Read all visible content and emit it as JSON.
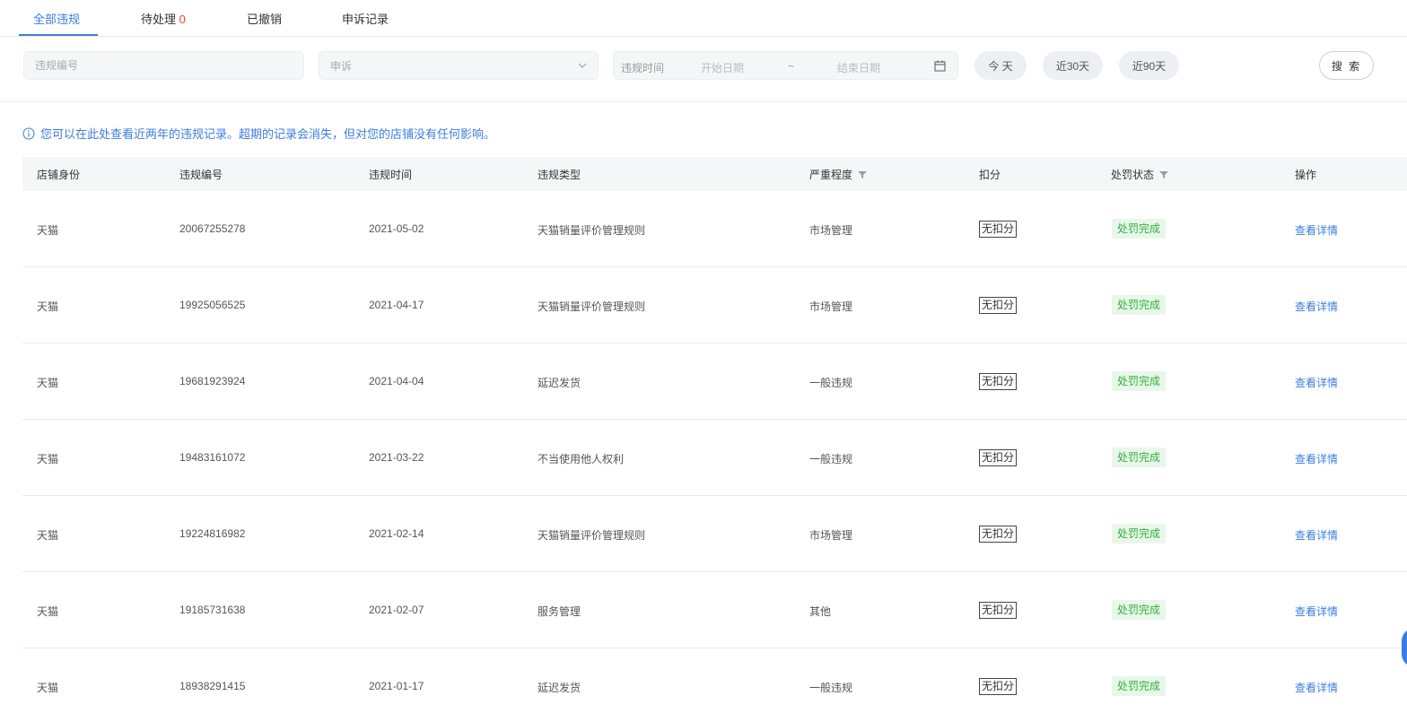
{
  "tabs": [
    {
      "label": "全部违规",
      "active": true
    },
    {
      "label": "待处理",
      "count": "0"
    },
    {
      "label": "已撤销"
    },
    {
      "label": "申诉记录"
    }
  ],
  "filters": {
    "violation_no_placeholder": "违规编号",
    "appeal_select_value": "申诉",
    "time_label": "违规时间",
    "start_placeholder": "开始日期",
    "separator": "~",
    "end_placeholder": "结束日期",
    "quick": [
      "今 天",
      "近30天",
      "近90天"
    ],
    "search_label": "搜 索"
  },
  "notice": "您可以在此处查看近两年的违规记录。超期的记录会消失，但对您的店铺没有任何影响。",
  "table": {
    "headers": [
      "店铺身份",
      "违规编号",
      "违规时间",
      "违规类型",
      "严重程度",
      "扣分",
      "处罚状态",
      "操作"
    ],
    "rows": [
      {
        "shop": "天猫",
        "id": "20067255278",
        "date": "2021-05-02",
        "type": "天猫销量评价管理规则",
        "severity": "市场管理",
        "score": "无扣分",
        "status": "处罚完成",
        "action": "查看详情"
      },
      {
        "shop": "天猫",
        "id": "19925056525",
        "date": "2021-04-17",
        "type": "天猫销量评价管理规则",
        "severity": "市场管理",
        "score": "无扣分",
        "status": "处罚完成",
        "action": "查看详情"
      },
      {
        "shop": "天猫",
        "id": "19681923924",
        "date": "2021-04-04",
        "type": "延迟发货",
        "severity": "一般违规",
        "score": "无扣分",
        "status": "处罚完成",
        "action": "查看详情"
      },
      {
        "shop": "天猫",
        "id": "19483161072",
        "date": "2021-03-22",
        "type": "不当使用他人权利",
        "severity": "一般违规",
        "score": "无扣分",
        "status": "处罚完成",
        "action": "查看详情"
      },
      {
        "shop": "天猫",
        "id": "19224816982",
        "date": "2021-02-14",
        "type": "天猫销量评价管理规则",
        "severity": "市场管理",
        "score": "无扣分",
        "status": "处罚完成",
        "action": "查看详情"
      },
      {
        "shop": "天猫",
        "id": "19185731638",
        "date": "2021-02-07",
        "type": "服务管理",
        "severity": "其他",
        "score": "无扣分",
        "status": "处罚完成",
        "action": "查看详情"
      },
      {
        "shop": "天猫",
        "id": "18938291415",
        "date": "2021-01-17",
        "type": "延迟发货",
        "severity": "一般违规",
        "score": "无扣分",
        "status": "处罚完成",
        "action": "查看详情"
      }
    ]
  },
  "colors": {
    "accent": "#3a7de0",
    "success": "#32b13c",
    "danger": "#ff3b30"
  }
}
